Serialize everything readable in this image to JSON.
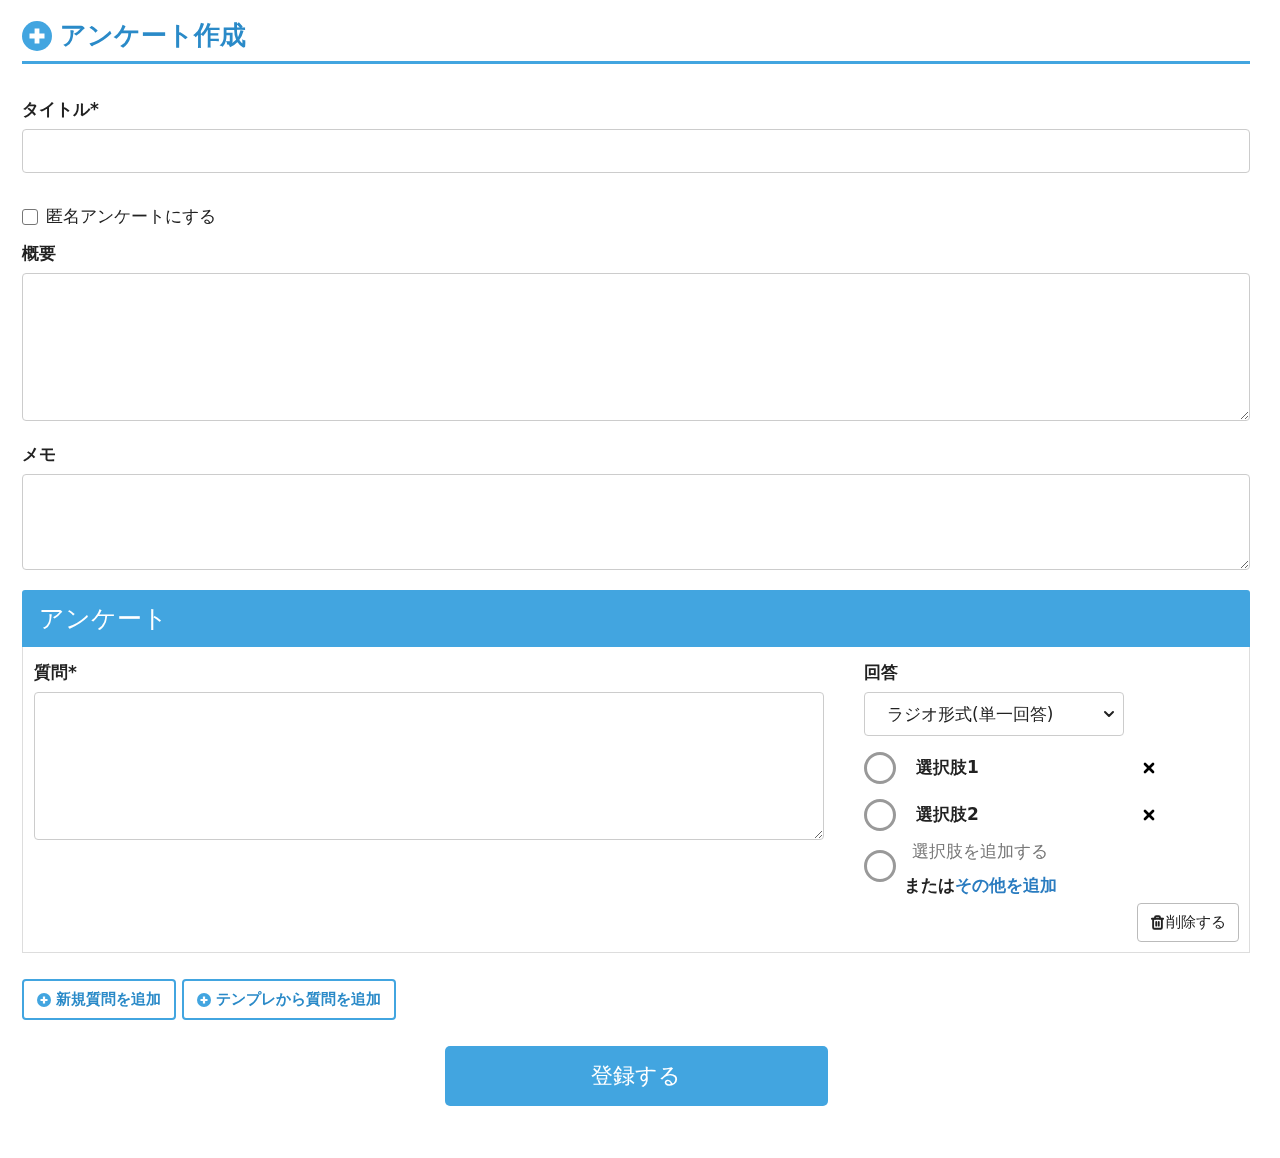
{
  "heading": "アンケート作成",
  "title_field": {
    "label": "タイトル*"
  },
  "anonymous": {
    "label": "匿名アンケートにする",
    "checked": false
  },
  "summary_field": {
    "label": "概要"
  },
  "memo_field": {
    "label": "メモ"
  },
  "survey": {
    "header": "アンケート",
    "question": {
      "label": "質問*"
    },
    "answer": {
      "label": "回答",
      "type_select": "ラジオ形式(単一回答)",
      "options": [
        {
          "label": "選択肢1",
          "selected": false
        },
        {
          "label": "選択肢2",
          "selected": false
        }
      ],
      "add_option": {
        "placeholder": "選択肢を追加する",
        "selected": false
      },
      "or_text": "または",
      "other_link": "その他を追加",
      "delete_button": "削除する"
    }
  },
  "add_buttons": [
    "新規質問を追加",
    "テンプレから質問を追加"
  ],
  "submit": "登録する"
}
